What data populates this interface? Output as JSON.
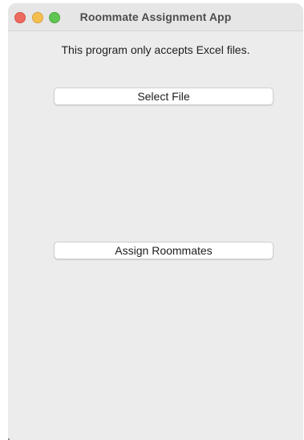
{
  "window": {
    "title": "Roommate Assignment App"
  },
  "main": {
    "info_text": "This program only accepts Excel files.",
    "select_file_label": "Select File",
    "assign_label": "Assign Roommates"
  },
  "colors": {
    "close": "#ed6a5e",
    "minimize": "#f5bf4f",
    "maximize": "#61c554",
    "background": "#ececec"
  }
}
